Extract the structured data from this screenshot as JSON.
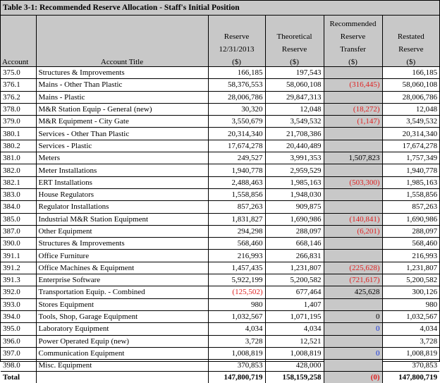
{
  "title": "Table 3-1: Recommended Reserve Allocation - Staff's Initial Position",
  "headers": {
    "account": "Account",
    "account_title": "Account Title",
    "reserve": [
      "Reserve",
      "12/31/2013",
      "($)"
    ],
    "theoretical": [
      "Theoretical",
      "Reserve",
      "($)"
    ],
    "transfer": [
      "Recommended",
      "Reserve",
      "Transfer",
      "($)"
    ],
    "restated": [
      "Restated",
      "Reserve",
      "($)"
    ]
  },
  "rows": [
    {
      "account": "375.0",
      "title": "Structures & Improvements",
      "reserve": "166,185",
      "theoretical": "197,543",
      "transfer": "",
      "restated": "166,185"
    },
    {
      "account": "376.1",
      "title": "Mains - Other Than Plastic",
      "reserve": "58,376,553",
      "theoretical": "58,060,108",
      "transfer": "(316,445)",
      "restated": "58,060,108"
    },
    {
      "account": "376.2",
      "title": "Mains - Plastic",
      "reserve": "28,006,786",
      "theoretical": "29,847,313",
      "transfer": "",
      "restated": "28,006,786"
    },
    {
      "account": "378.0",
      "title": "M&R Station Equip - General (new)",
      "reserve": "30,320",
      "theoretical": "12,048",
      "transfer": "(18,272)",
      "restated": "12,048"
    },
    {
      "account": "379.0",
      "title": "M&R Equipment - City Gate",
      "reserve": "3,550,679",
      "theoretical": "3,549,532",
      "transfer": "(1,147)",
      "restated": "3,549,532"
    },
    {
      "account": "380.1",
      "title": "Services - Other Than Plastic",
      "reserve": "20,314,340",
      "theoretical": "21,708,386",
      "transfer": "",
      "restated": "20,314,340"
    },
    {
      "account": "380.2",
      "title": "Services - Plastic",
      "reserve": "17,674,278",
      "theoretical": "20,440,489",
      "transfer": "",
      "restated": "17,674,278"
    },
    {
      "account": "381.0",
      "title": "Meters",
      "reserve": "249,527",
      "theoretical": "3,991,353",
      "transfer": "1,507,823",
      "restated": "1,757,349"
    },
    {
      "account": "382.0",
      "title": "Meter Installations",
      "reserve": "1,940,778",
      "theoretical": "2,959,529",
      "transfer": "",
      "restated": "1,940,778"
    },
    {
      "account": "382.1",
      "title": "ERT Installations",
      "reserve": "2,488,463",
      "theoretical": "1,985,163",
      "transfer": "(503,300)",
      "restated": "1,985,163"
    },
    {
      "account": "383.0",
      "title": "House Regulators",
      "reserve": "1,558,856",
      "theoretical": "1,948,030",
      "transfer": "",
      "restated": "1,558,856"
    },
    {
      "account": "384.0",
      "title": "Regulator Installations",
      "reserve": "857,263",
      "theoretical": "909,875",
      "transfer": "",
      "restated": "857,263"
    },
    {
      "account": "385.0",
      "title": "Industrial M&R Station Equipment",
      "reserve": "1,831,827",
      "theoretical": "1,690,986",
      "transfer": "(140,841)",
      "restated": "1,690,986"
    },
    {
      "account": "387.0",
      "title": "Other Equipment",
      "reserve": "294,298",
      "theoretical": "288,097",
      "transfer": "(6,201)",
      "restated": "288,097"
    },
    {
      "account": "390.0",
      "title": "Structures & Improvements",
      "reserve": "568,460",
      "theoretical": "668,146",
      "transfer": "",
      "restated": "568,460"
    },
    {
      "account": "391.1",
      "title": "Office Furniture",
      "reserve": "216,993",
      "theoretical": "266,831",
      "transfer": "",
      "restated": "216,993"
    },
    {
      "account": "391.2",
      "title": "Office Machines & Equipment",
      "reserve": "1,457,435",
      "theoretical": "1,231,807",
      "transfer": "(225,628)",
      "restated": "1,231,807"
    },
    {
      "account": "391.3",
      "title": "Enterprise Software",
      "reserve": "5,922,199",
      "theoretical": "5,200,582",
      "transfer": "(721,617)",
      "restated": "5,200,582"
    },
    {
      "account": "392.0",
      "title": "Transportation Equip. - Combined",
      "reserve": "(125,502)",
      "theoretical": "677,464",
      "transfer": "425,628",
      "restated": "300,126"
    },
    {
      "account": "393.0",
      "title": "Stores Equipment",
      "reserve": "980",
      "theoretical": "1,407",
      "transfer": "",
      "restated": "980"
    },
    {
      "account": "394.0",
      "title": "Tools, Shop, Garage Equipment",
      "reserve": "1,032,567",
      "theoretical": "1,071,195",
      "transfer": "0",
      "restated": "1,032,567"
    },
    {
      "account": "395.0",
      "title": "Laboratory Equipment",
      "reserve": "4,034",
      "theoretical": "4,034",
      "transfer": "0",
      "restated": "4,034"
    },
    {
      "account": "396.0",
      "title": "Power Operated Equip (new)",
      "reserve": "3,728",
      "theoretical": "12,521",
      "transfer": "",
      "restated": "3,728"
    },
    {
      "account": "397.0",
      "title": "Communication Equipment",
      "reserve": "1,008,819",
      "theoretical": "1,008,819",
      "transfer": "0",
      "restated": "1,008,819"
    },
    {
      "account": "398.0",
      "title": "Misc. Equipment",
      "reserve": "370,853",
      "theoretical": "428,000",
      "transfer": "",
      "restated": "370,853"
    }
  ],
  "total": {
    "label": "Total",
    "reserve": "147,800,719",
    "theoretical": "158,159,258",
    "transfer": "(0)",
    "restated": "147,800,719"
  },
  "colors": {
    "header_bg": "#c8c8c8",
    "negative": "#e02020",
    "zero_blue": "#1030e0"
  }
}
